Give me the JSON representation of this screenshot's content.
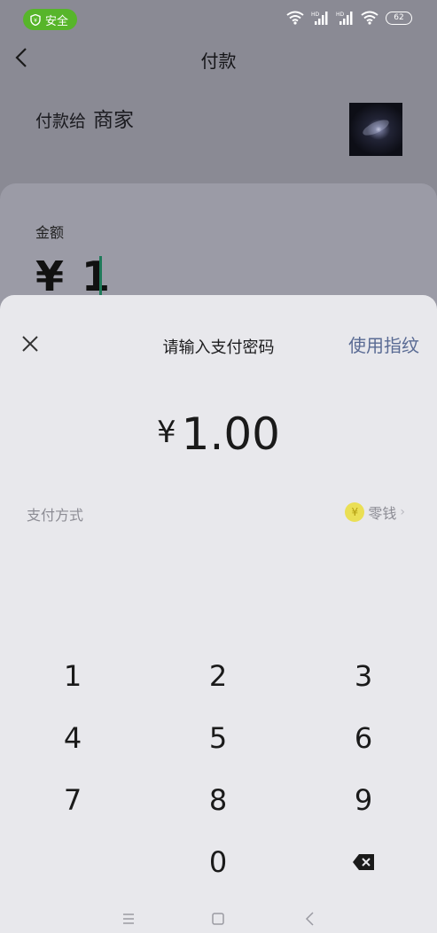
{
  "status_bar": {
    "safety_label": "安全",
    "battery": "62",
    "signal1_tag": "HD",
    "signal2_tag": "HD"
  },
  "header": {
    "title": "付款"
  },
  "payee": {
    "prefix": "付款给",
    "name": "商家"
  },
  "amount_card": {
    "label": "金额",
    "value": "¥ 1"
  },
  "password_sheet": {
    "title": "请输入支付密码",
    "fingerprint_label": "使用指纹",
    "currency_symbol": "¥",
    "amount": "1.00",
    "method_label": "支付方式",
    "method_value": "零钱"
  },
  "keypad": {
    "keys": [
      "1",
      "2",
      "3",
      "4",
      "5",
      "6",
      "7",
      "8",
      "9",
      "0"
    ]
  },
  "colors": {
    "accent": "#5a6b94",
    "safe_green": "#57b52a",
    "coin_yellow": "#eadf55"
  }
}
